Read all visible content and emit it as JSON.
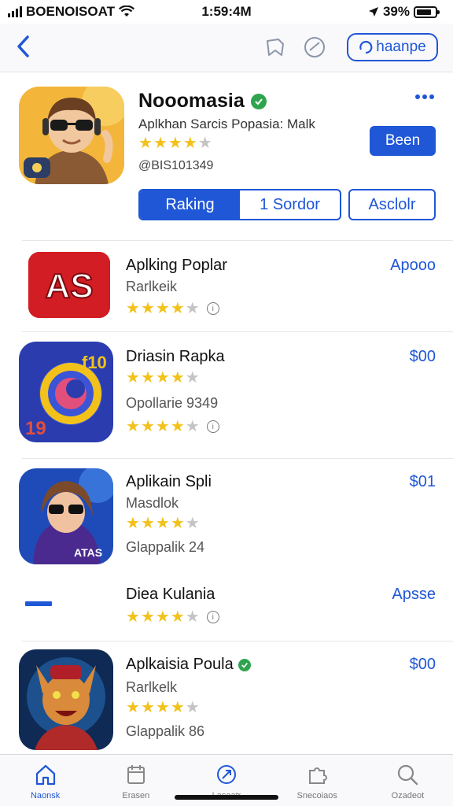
{
  "status_bar": {
    "carrier": "BOENOISOAT",
    "time": "1:59:4M",
    "battery": "39%"
  },
  "nav": {
    "pill_label": "haanpe"
  },
  "hero": {
    "title": "Nooomasia",
    "subtitle": "Aplkhan Sarcis Popasia: Malk",
    "rating": 3.5,
    "id_text": "@BIS101349",
    "get_label": "Been",
    "segments": [
      "Raking",
      "1 Sordor"
    ],
    "alt_button": "Asclolr"
  },
  "apps": [
    {
      "name": "Aplking Poplar",
      "sub": "Rarlkeik",
      "sub2": "",
      "rating": 3.5,
      "rating2": null,
      "price": "Apooo",
      "verified": false,
      "icon": "red-as-logo-icon"
    },
    {
      "name": "Driasin Rapka",
      "sub": "",
      "sub2": "Opollarie 9349",
      "rating": 3.5,
      "rating2": 3.5,
      "price": "$00",
      "verified": false,
      "icon": "blue-ring-icon"
    },
    {
      "name": "Aplikain Spli",
      "sub": "Masdlok",
      "sub2": "Glappalik 24",
      "rating": 3.5,
      "rating2": null,
      "price": "$01",
      "verified": false,
      "icon": "hoodie-girl-icon"
    },
    {
      "name": "Diea Kulania",
      "sub": "",
      "sub2": "",
      "rating": 3.5,
      "rating2": null,
      "price": "Apsse",
      "verified": false,
      "icon": "dash-icon"
    },
    {
      "name": "Aplkaisia Poula",
      "sub": "Rarlkelk",
      "sub2": "Glappalik 86",
      "rating": 4,
      "rating2": null,
      "price": "$00",
      "verified": true,
      "icon": "wolf-mascot-icon"
    }
  ],
  "tabs": [
    {
      "label": "Naonsk",
      "icon": "home-icon",
      "active": true
    },
    {
      "label": "Erasen",
      "icon": "calendar-icon",
      "active": false
    },
    {
      "label": "Lasaatr",
      "icon": "share-icon",
      "active": false
    },
    {
      "label": "Snecoiaos",
      "icon": "puzzle-icon",
      "active": false
    },
    {
      "label": "Ozadeot",
      "icon": "search-icon",
      "active": false
    }
  ],
  "colors": {
    "accent": "#1f57d6",
    "star": "#f2c21b",
    "verified": "#2ea44f"
  }
}
